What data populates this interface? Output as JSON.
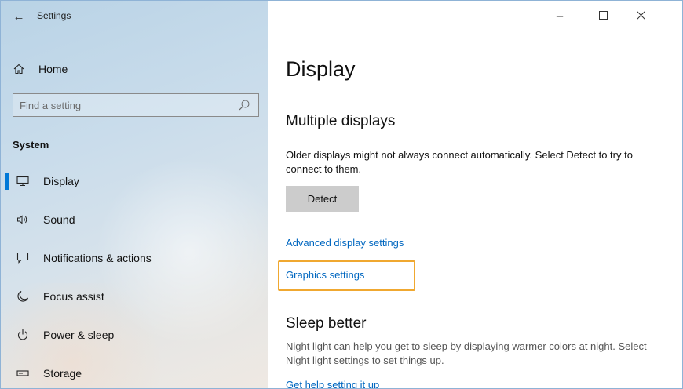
{
  "window": {
    "title": "Settings"
  },
  "sidebar": {
    "home_label": "Home",
    "search_placeholder": "Find a setting",
    "section_label": "System",
    "items": [
      {
        "label": "Display",
        "icon": "monitor-icon",
        "active": true
      },
      {
        "label": "Sound",
        "icon": "speaker-icon",
        "active": false
      },
      {
        "label": "Notifications & actions",
        "icon": "message-icon",
        "active": false
      },
      {
        "label": "Focus assist",
        "icon": "moon-icon",
        "active": false
      },
      {
        "label": "Power & sleep",
        "icon": "power-icon",
        "active": false
      },
      {
        "label": "Storage",
        "icon": "storage-icon",
        "active": false
      }
    ]
  },
  "main": {
    "page_title": "Display",
    "multiple_displays": {
      "heading": "Multiple displays",
      "description": "Older displays might not always connect automatically. Select Detect to try to connect to them.",
      "detect_label": "Detect",
      "advanced_link": "Advanced display settings",
      "graphics_link": "Graphics settings"
    },
    "sleep_better": {
      "heading": "Sleep better",
      "description": "Night light can help you get to sleep by displaying warmer colors at night. Select Night light settings to set things up.",
      "help_link": "Get help setting it up"
    }
  },
  "colors": {
    "accent": "#0078d7",
    "link": "#0067c0",
    "highlight": "#f0a830"
  }
}
